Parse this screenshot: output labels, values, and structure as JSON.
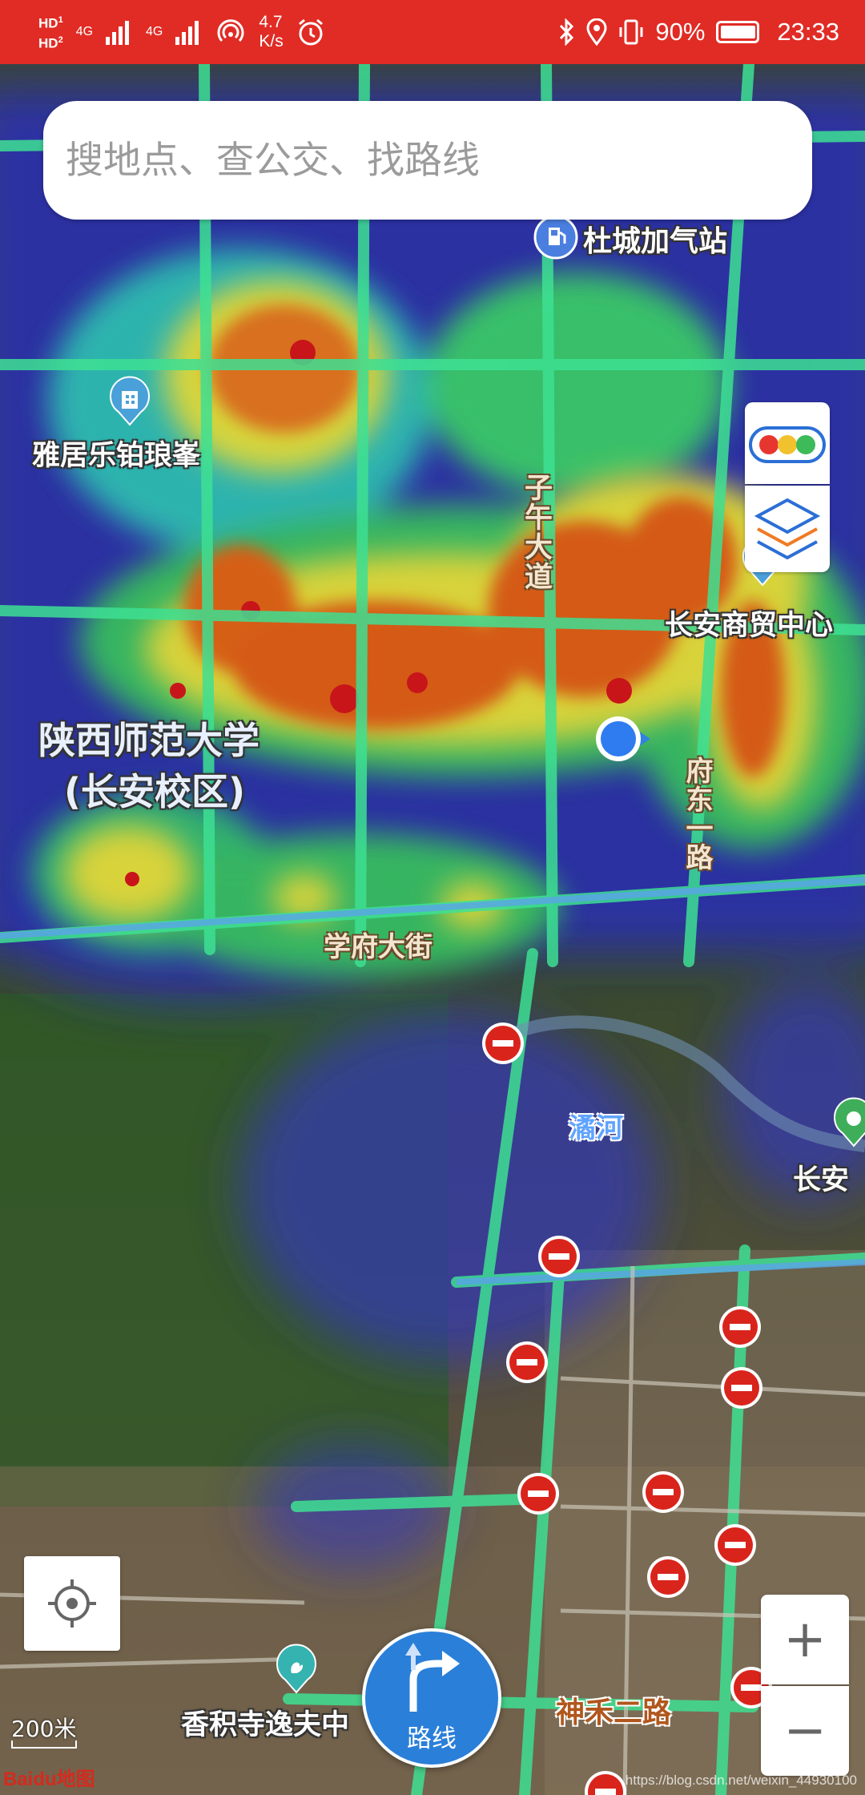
{
  "status_bar": {
    "hd1": "HD",
    "hd1_sub": "1",
    "hd2": "HD",
    "hd2_sub": "2",
    "net1": "4G",
    "net2": "4G",
    "speed_value": "4.7",
    "speed_unit": "K/s",
    "battery": "90%",
    "time": "23:33"
  },
  "search": {
    "placeholder": "搜地点、查公交、找路线"
  },
  "map_labels": {
    "gas_station": "杜城加气站",
    "residence": "雅居乐铂琅峯",
    "ziwu_avenue": "子午大道",
    "changan_trade_center": "长安商贸中心",
    "university_line1": "陕西师范大学",
    "university_line2": "(长安校区)",
    "fudong_road": "府东一路",
    "xuefu_street": "学府大街",
    "river": "潏河",
    "changan_partial": "长安",
    "temple": "香积寺逸夫中",
    "shenhe_road": "神禾二路"
  },
  "route_button": {
    "label": "路线"
  },
  "scale": {
    "label": "200米"
  },
  "logo_text": "Baidu地图",
  "watermark": "https://blog.csdn.net/weixin_44930100",
  "colors": {
    "status_bar": "#e02c25",
    "route_button": "#2a7fd9",
    "no_entry": "#d9241c",
    "location_dot": "#2f7cf0"
  }
}
